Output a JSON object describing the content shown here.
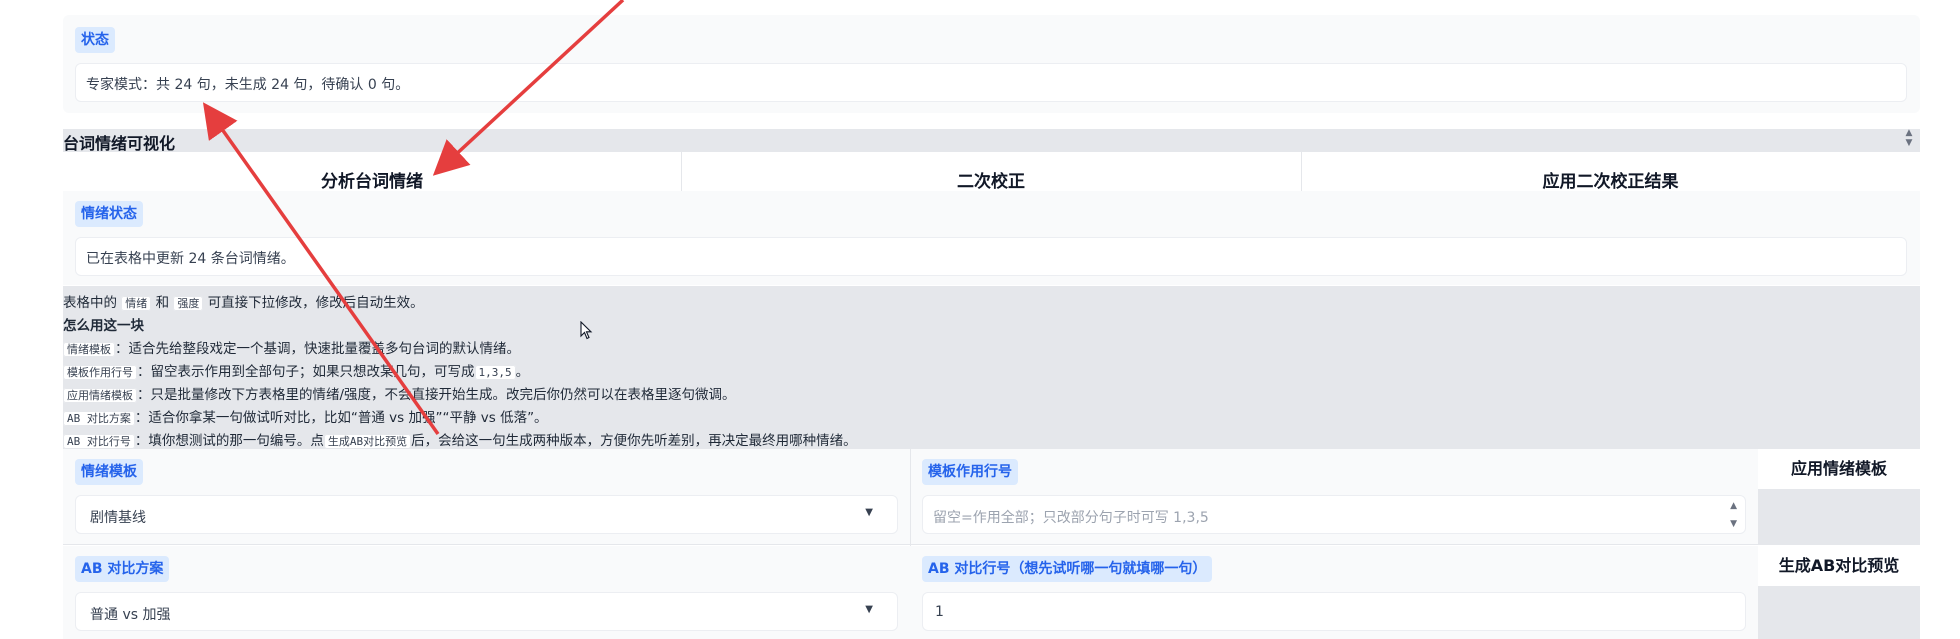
{
  "status_section": {
    "badge": "状态",
    "text": "专家模式：共 24 句，未生成 24 句，待确认 0 句。"
  },
  "emotion_viz": {
    "title": "台词情绪可视化",
    "buttons": [
      "分析台词情绪",
      "二次校正",
      "应用二次校正结果"
    ]
  },
  "emotion_status": {
    "badge": "情绪状态",
    "text": "已在表格中更新 24 条台词情绪。"
  },
  "help": {
    "l1_a": "表格中的",
    "l1_code1": "情绪",
    "l1_b": "和",
    "l1_code2": "强度",
    "l1_c": "可直接下拉修改，修改后自动生效。",
    "heading": "怎么用这一块",
    "l2_code": "情绪模板",
    "l2_text": "：适合先给整段戏定一个基调，快速批量覆盖多句台词的默认情绪。",
    "l3_code": "模板作用行号",
    "l3_text": "：留空表示作用到全部句子；如果只想改某几句，可写成",
    "l3_code2": "1,3,5",
    "l3_end": "。",
    "l4_code": "应用情绪模板",
    "l4_text": "：只是批量修改下方表格里的情绪/强度，不会直接开始生成。改完后你仍然可以在表格里逐句微调。",
    "l5_code": "AB 对比方案",
    "l5_text": "：适合你拿某一句做试听对比，比如“普通 vs 加强”“平静 vs 低落”。",
    "l6_code": "AB 对比行号",
    "l6_text": "：填你想测试的那一句编号。点",
    "l6_code2": "生成AB对比预览",
    "l6_end": "后，会给这一句生成两种版本，方便你先听差别，再决定最终用哪种情绪。"
  },
  "template_row": {
    "template_label": "情绪模板",
    "template_value": "剧情基线",
    "rows_label": "模板作用行号",
    "rows_placeholder": "留空=作用全部；只改部分句子时可写 1,3,5",
    "apply_button": "应用情绪模板"
  },
  "ab_row": {
    "scheme_label": "AB 对比方案",
    "scheme_value": "普通 vs 加强",
    "row_label": "AB 对比行号（想先试听哪一句就填哪一句）",
    "row_value": "1",
    "preview_button": "生成AB对比预览"
  },
  "colors": {
    "badge_bg": "#dbeafe",
    "badge_text": "#2563eb",
    "panel_gray": "#e5e7eb",
    "annotation_red": "#e53e3e"
  }
}
